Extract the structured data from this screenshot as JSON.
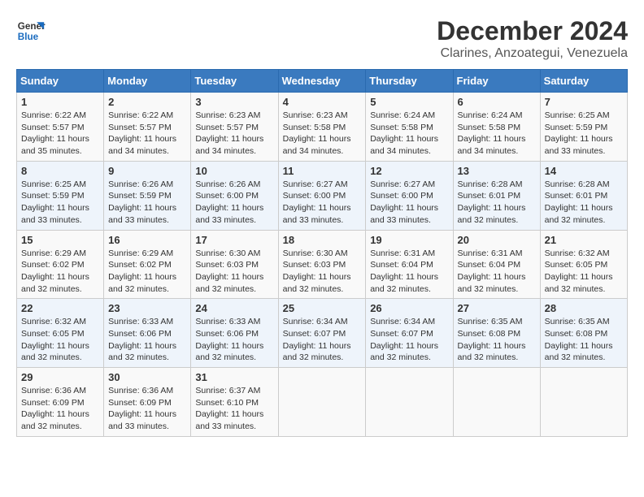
{
  "logo": {
    "line1": "General",
    "line2": "Blue"
  },
  "title": "December 2024",
  "location": "Clarines, Anzoategui, Venezuela",
  "days_of_week": [
    "Sunday",
    "Monday",
    "Tuesday",
    "Wednesday",
    "Thursday",
    "Friday",
    "Saturday"
  ],
  "weeks": [
    [
      {
        "day": "1",
        "info": "Sunrise: 6:22 AM\nSunset: 5:57 PM\nDaylight: 11 hours\nand 35 minutes."
      },
      {
        "day": "2",
        "info": "Sunrise: 6:22 AM\nSunset: 5:57 PM\nDaylight: 11 hours\nand 34 minutes."
      },
      {
        "day": "3",
        "info": "Sunrise: 6:23 AM\nSunset: 5:57 PM\nDaylight: 11 hours\nand 34 minutes."
      },
      {
        "day": "4",
        "info": "Sunrise: 6:23 AM\nSunset: 5:58 PM\nDaylight: 11 hours\nand 34 minutes."
      },
      {
        "day": "5",
        "info": "Sunrise: 6:24 AM\nSunset: 5:58 PM\nDaylight: 11 hours\nand 34 minutes."
      },
      {
        "day": "6",
        "info": "Sunrise: 6:24 AM\nSunset: 5:58 PM\nDaylight: 11 hours\nand 34 minutes."
      },
      {
        "day": "7",
        "info": "Sunrise: 6:25 AM\nSunset: 5:59 PM\nDaylight: 11 hours\nand 33 minutes."
      }
    ],
    [
      {
        "day": "8",
        "info": "Sunrise: 6:25 AM\nSunset: 5:59 PM\nDaylight: 11 hours\nand 33 minutes."
      },
      {
        "day": "9",
        "info": "Sunrise: 6:26 AM\nSunset: 5:59 PM\nDaylight: 11 hours\nand 33 minutes."
      },
      {
        "day": "10",
        "info": "Sunrise: 6:26 AM\nSunset: 6:00 PM\nDaylight: 11 hours\nand 33 minutes."
      },
      {
        "day": "11",
        "info": "Sunrise: 6:27 AM\nSunset: 6:00 PM\nDaylight: 11 hours\nand 33 minutes."
      },
      {
        "day": "12",
        "info": "Sunrise: 6:27 AM\nSunset: 6:00 PM\nDaylight: 11 hours\nand 33 minutes."
      },
      {
        "day": "13",
        "info": "Sunrise: 6:28 AM\nSunset: 6:01 PM\nDaylight: 11 hours\nand 32 minutes."
      },
      {
        "day": "14",
        "info": "Sunrise: 6:28 AM\nSunset: 6:01 PM\nDaylight: 11 hours\nand 32 minutes."
      }
    ],
    [
      {
        "day": "15",
        "info": "Sunrise: 6:29 AM\nSunset: 6:02 PM\nDaylight: 11 hours\nand 32 minutes."
      },
      {
        "day": "16",
        "info": "Sunrise: 6:29 AM\nSunset: 6:02 PM\nDaylight: 11 hours\nand 32 minutes."
      },
      {
        "day": "17",
        "info": "Sunrise: 6:30 AM\nSunset: 6:03 PM\nDaylight: 11 hours\nand 32 minutes."
      },
      {
        "day": "18",
        "info": "Sunrise: 6:30 AM\nSunset: 6:03 PM\nDaylight: 11 hours\nand 32 minutes."
      },
      {
        "day": "19",
        "info": "Sunrise: 6:31 AM\nSunset: 6:04 PM\nDaylight: 11 hours\nand 32 minutes."
      },
      {
        "day": "20",
        "info": "Sunrise: 6:31 AM\nSunset: 6:04 PM\nDaylight: 11 hours\nand 32 minutes."
      },
      {
        "day": "21",
        "info": "Sunrise: 6:32 AM\nSunset: 6:05 PM\nDaylight: 11 hours\nand 32 minutes."
      }
    ],
    [
      {
        "day": "22",
        "info": "Sunrise: 6:32 AM\nSunset: 6:05 PM\nDaylight: 11 hours\nand 32 minutes."
      },
      {
        "day": "23",
        "info": "Sunrise: 6:33 AM\nSunset: 6:06 PM\nDaylight: 11 hours\nand 32 minutes."
      },
      {
        "day": "24",
        "info": "Sunrise: 6:33 AM\nSunset: 6:06 PM\nDaylight: 11 hours\nand 32 minutes."
      },
      {
        "day": "25",
        "info": "Sunrise: 6:34 AM\nSunset: 6:07 PM\nDaylight: 11 hours\nand 32 minutes."
      },
      {
        "day": "26",
        "info": "Sunrise: 6:34 AM\nSunset: 6:07 PM\nDaylight: 11 hours\nand 32 minutes."
      },
      {
        "day": "27",
        "info": "Sunrise: 6:35 AM\nSunset: 6:08 PM\nDaylight: 11 hours\nand 32 minutes."
      },
      {
        "day": "28",
        "info": "Sunrise: 6:35 AM\nSunset: 6:08 PM\nDaylight: 11 hours\nand 32 minutes."
      }
    ],
    [
      {
        "day": "29",
        "info": "Sunrise: 6:36 AM\nSunset: 6:09 PM\nDaylight: 11 hours\nand 32 minutes."
      },
      {
        "day": "30",
        "info": "Sunrise: 6:36 AM\nSunset: 6:09 PM\nDaylight: 11 hours\nand 33 minutes."
      },
      {
        "day": "31",
        "info": "Sunrise: 6:37 AM\nSunset: 6:10 PM\nDaylight: 11 hours\nand 33 minutes."
      },
      {
        "day": "",
        "info": ""
      },
      {
        "day": "",
        "info": ""
      },
      {
        "day": "",
        "info": ""
      },
      {
        "day": "",
        "info": ""
      }
    ]
  ]
}
